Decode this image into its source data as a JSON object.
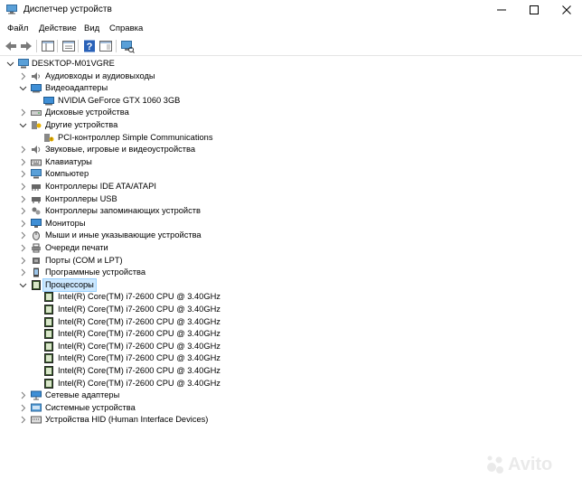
{
  "window": {
    "title": "Диспетчер устройств"
  },
  "menu": [
    "Файл",
    "Действие",
    "Вид",
    "Справка"
  ],
  "toolbar": [
    "back",
    "forward",
    "show-hide-console-tree",
    "properties",
    "help",
    "action-pane",
    "scan-hardware"
  ],
  "tree": {
    "root": "DESKTOP-M01VGRE",
    "categories": [
      {
        "label": "Аудиовходы и аудиовыходы",
        "icon": "speaker-icon",
        "expanded": false
      },
      {
        "label": "Видеоадаптеры",
        "icon": "display-adapter-icon",
        "expanded": true,
        "children": [
          "NVIDIA GeForce GTX 1060 3GB"
        ]
      },
      {
        "label": "Дисковые устройства",
        "icon": "disk-drive-icon",
        "expanded": false
      },
      {
        "label": "Другие устройства",
        "icon": "unknown-device-icon",
        "expanded": true,
        "children": [
          "PCI-контроллер Simple Communications"
        ]
      },
      {
        "label": "Звуковые, игровые и видеоустройства",
        "icon": "sound-icon",
        "expanded": false
      },
      {
        "label": "Клавиатуры",
        "icon": "keyboard-icon",
        "expanded": false
      },
      {
        "label": "Компьютер",
        "icon": "computer-icon",
        "expanded": false
      },
      {
        "label": "Контроллеры IDE ATA/ATAPI",
        "icon": "ide-controller-icon",
        "expanded": false
      },
      {
        "label": "Контроллеры USB",
        "icon": "usb-icon",
        "expanded": false
      },
      {
        "label": "Контроллеры запоминающих устройств",
        "icon": "storage-controller-icon",
        "expanded": false
      },
      {
        "label": "Мониторы",
        "icon": "monitor-icon",
        "expanded": false
      },
      {
        "label": "Мыши и иные указывающие устройства",
        "icon": "mouse-icon",
        "expanded": false
      },
      {
        "label": "Очереди печати",
        "icon": "printer-icon",
        "expanded": false
      },
      {
        "label": "Порты (COM и LPT)",
        "icon": "port-icon",
        "expanded": false
      },
      {
        "label": "Программные устройства",
        "icon": "software-device-icon",
        "expanded": false
      },
      {
        "label": "Процессоры",
        "icon": "processor-icon",
        "expanded": true,
        "selected": true,
        "children": [
          "Intel(R) Core(TM) i7-2600 CPU @ 3.40GHz",
          "Intel(R) Core(TM) i7-2600 CPU @ 3.40GHz",
          "Intel(R) Core(TM) i7-2600 CPU @ 3.40GHz",
          "Intel(R) Core(TM) i7-2600 CPU @ 3.40GHz",
          "Intel(R) Core(TM) i7-2600 CPU @ 3.40GHz",
          "Intel(R) Core(TM) i7-2600 CPU @ 3.40GHz",
          "Intel(R) Core(TM) i7-2600 CPU @ 3.40GHz",
          "Intel(R) Core(TM) i7-2600 CPU @ 3.40GHz"
        ]
      },
      {
        "label": "Сетевые адаптеры",
        "icon": "network-adapter-icon",
        "expanded": false
      },
      {
        "label": "Системные устройства",
        "icon": "system-device-icon",
        "expanded": false
      },
      {
        "label": "Устройства HID (Human Interface Devices)",
        "icon": "hid-icon",
        "expanded": false
      }
    ]
  },
  "colors": {
    "selection": "#cce8ff",
    "selection_border": "#99d1ff",
    "accent": "#0078d7"
  },
  "watermark": {
    "text": "Avito"
  }
}
